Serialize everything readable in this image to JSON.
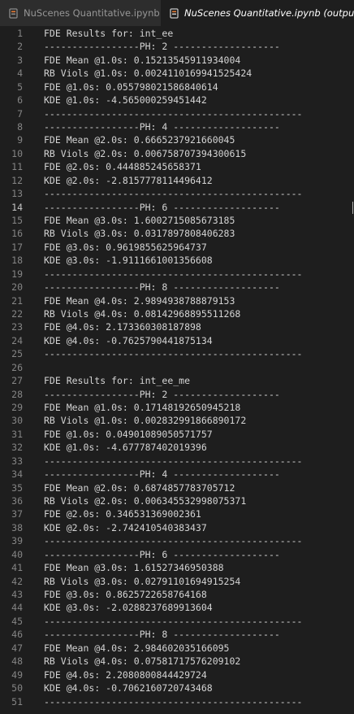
{
  "tabs": [
    {
      "label": "NuScenes Quantitative.ipynb",
      "icon": "notebook-icon",
      "active": false
    },
    {
      "label": "NuScenes Quantitative.ipynb (output)",
      "icon": "notebook-icon",
      "active": true
    }
  ],
  "current_line": 14,
  "lines": [
    "FDE Results for: int_ee",
    "-----------------PH: 2 -------------------",
    "FDE Mean @1.0s: 0.1521354591193400​4",
    "RB Viols @1.0s: 0.002411016994152542​4",
    "FDE @1.0s: 0.05579802158684061​4",
    "KDE @1.0s: -4.565000259451442",
    "----------------------------------------------",
    "-----------------PH: 4 -------------------",
    "FDE Mean @2.0s: 0.6665237921660045",
    "RB Viols @2.0s: 0.006758707394300615",
    "FDE @2.0s: 0.444885245658371",
    "KDE @2.0s: -2.815777811449641​2",
    "----------------------------------------------",
    "-----------------PH: 6 -------------------",
    "FDE Mean @3.0s: 1.6002715085673185",
    "RB Viols @3.0s: 0.0317897808406283",
    "FDE @3.0s: 0.961985562596473​7",
    "KDE @3.0s: -1.911166100135660​8",
    "----------------------------------------------",
    "-----------------PH: 8 -------------------",
    "FDE Mean @4.0s: 2.989493878887915​3",
    "RB Viols @4.0s: 0.08142968895511268",
    "FDE @4.0s: 2.173360308187898",
    "KDE @4.0s: -0.7625790441875134",
    "----------------------------------------------",
    "",
    "FDE Results for: int_ee_me",
    "-----------------PH: 2 -------------------",
    "FDE Mean @1.0s: 0.17148192650945218",
    "RB Viols @1.0s: 0.002832991866890172",
    "FDE @1.0s: 0.0490108905057175​7",
    "KDE @1.0s: -4.677787402019396",
    "----------------------------------------------",
    "-----------------PH: 4 -------------------",
    "FDE Mean @2.0s: 0.6874857783705712",
    "RB Viols @2.0s: 0.006345532998075371",
    "FDE @2.0s: 0.346531369002361",
    "KDE @2.0s: -2.742410540383437",
    "----------------------------------------------",
    "-----------------PH: 6 -------------------",
    "FDE Mean @3.0s: 1.61527346950388",
    "RB Viols @3.0s: 0.02791101694915254",
    "FDE @3.0s: 0.862572265876416​8",
    "KDE @3.0s: -2.028823768991360​4",
    "----------------------------------------------",
    "-----------------PH: 8 -------------------",
    "FDE Mean @4.0s: 2.984602035166095",
    "RB Viols @4.0s: 0.07581717576209102",
    "FDE @4.0s: 2.208080084442972​4",
    "KDE @4.0s: -0.706216072074346​8",
    "----------------------------------------------"
  ],
  "colors": {
    "editor_bg": "#1e1e1e",
    "tabbar_bg": "#252526",
    "text": "#d4d4d4",
    "line_number": "#858585",
    "icon_orange": "#e37933"
  }
}
